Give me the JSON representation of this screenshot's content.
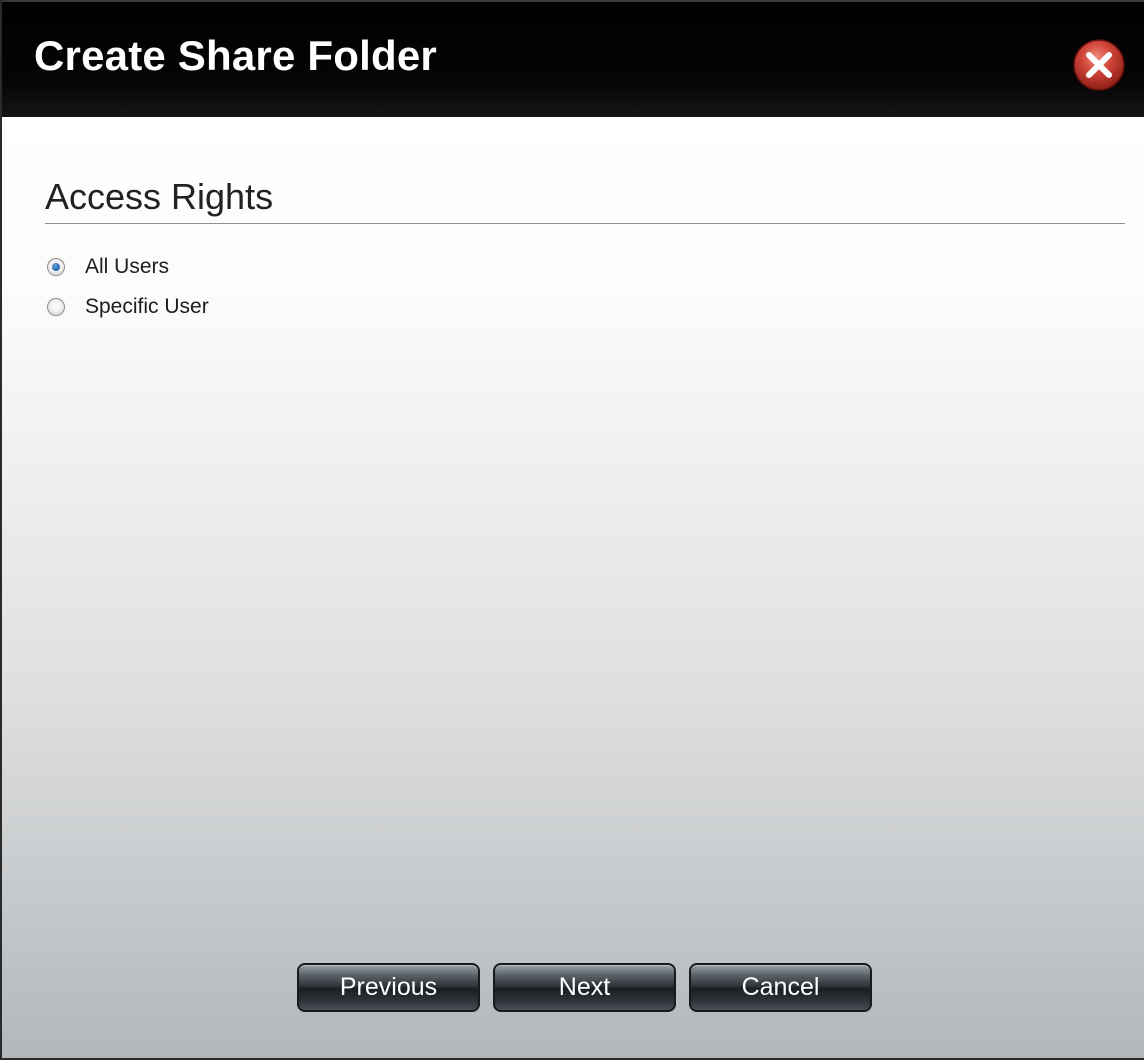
{
  "dialog": {
    "title": "Create Share Folder",
    "close_icon": "close-icon"
  },
  "section": {
    "title": "Access Rights"
  },
  "access_options": [
    {
      "label": "All Users",
      "selected": true
    },
    {
      "label": "Specific User",
      "selected": false
    }
  ],
  "buttons": {
    "previous": "Previous",
    "next": "Next",
    "cancel": "Cancel"
  },
  "colors": {
    "titlebar": "#000000",
    "close_button": "#c0392b",
    "radio_selected": "#1f5fa8"
  }
}
